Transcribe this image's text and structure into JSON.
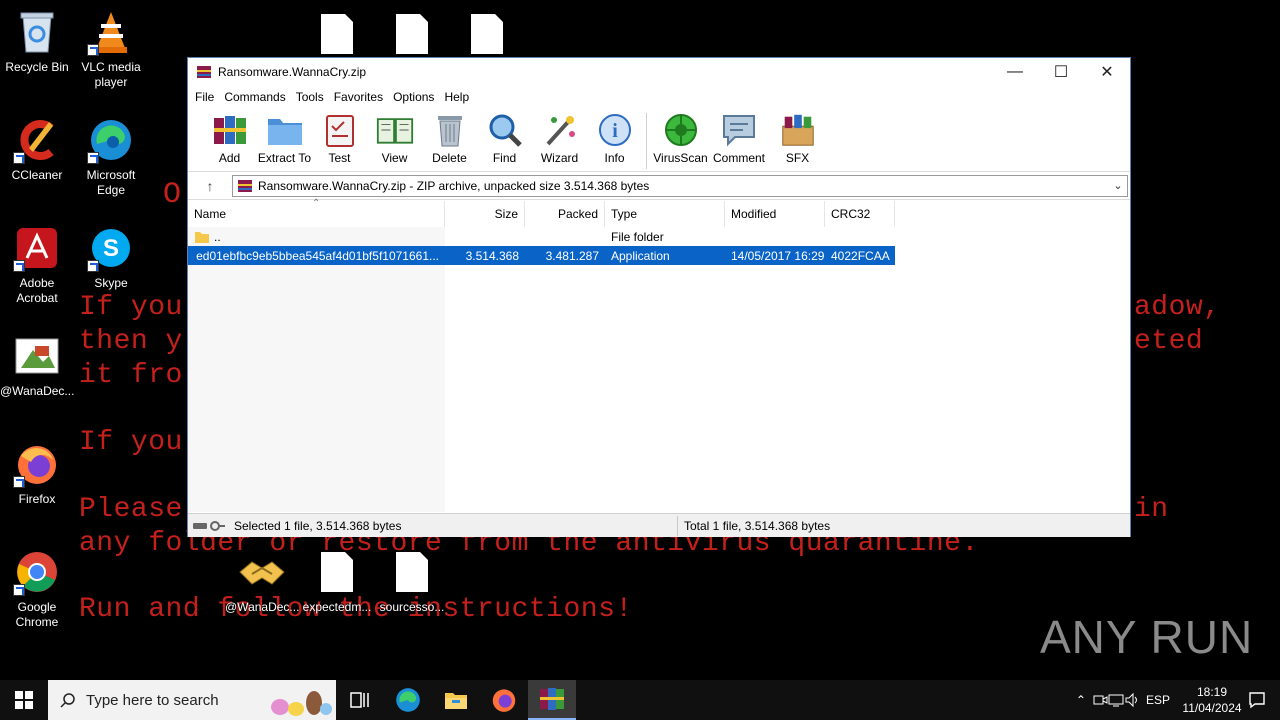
{
  "wallpaper": {
    "big_letter": "O",
    "lines": [
      "If you",
      "then y",
      "it fro",
      "If you",
      "Please",
      "any folder or restore from the antivirus quarantine.",
      "Run and follow the instructions!"
    ],
    "right_fragments": [
      "adow,",
      "eted",
      "in"
    ]
  },
  "desktop": {
    "icons_left": [
      {
        "label": "Recycle Bin",
        "icon": "recycle-bin-icon"
      },
      {
        "label": "VLC media player",
        "icon": "vlc-icon"
      },
      {
        "label": "CCleaner",
        "icon": "ccleaner-icon"
      },
      {
        "label": "Microsoft Edge",
        "icon": "edge-icon"
      },
      {
        "label": "Adobe Acrobat",
        "icon": "acrobat-icon"
      },
      {
        "label": "Skype",
        "icon": "skype-icon"
      },
      {
        "label": "@WanaDec...",
        "icon": "wanadecryptor-image-icon"
      },
      {
        "label": "Firefox",
        "icon": "firefox-icon"
      },
      {
        "label": "Google Chrome",
        "icon": "chrome-icon"
      }
    ],
    "icons_bottom": [
      {
        "label": "@WanaDec...",
        "icon": "handshake-icon"
      },
      {
        "label": "expectedm...",
        "icon": "file-icon"
      },
      {
        "label": "sourcesso...",
        "icon": "file-icon"
      }
    ]
  },
  "window": {
    "title": "Ransomware.WannaCry.zip",
    "menu": [
      "File",
      "Commands",
      "Tools",
      "Favorites",
      "Options",
      "Help"
    ],
    "toolbar": [
      {
        "label": "Add",
        "icon": "add-archive-icon"
      },
      {
        "label": "Extract To",
        "icon": "extract-folder-icon"
      },
      {
        "label": "Test",
        "icon": "test-clipboard-icon"
      },
      {
        "label": "View",
        "icon": "view-book-icon"
      },
      {
        "label": "Delete",
        "icon": "trash-icon"
      },
      {
        "label": "Find",
        "icon": "magnifier-icon"
      },
      {
        "label": "Wizard",
        "icon": "magic-wand-icon"
      },
      {
        "label": "Info",
        "icon": "info-icon"
      },
      {
        "label": "VirusScan",
        "icon": "virus-scan-icon"
      },
      {
        "label": "Comment",
        "icon": "comment-icon"
      },
      {
        "label": "SFX",
        "icon": "sfx-box-icon"
      }
    ],
    "address": "Ransomware.WannaCry.zip - ZIP archive, unpacked size 3.514.368 bytes",
    "columns": [
      "Name",
      "Size",
      "Packed",
      "Type",
      "Modified",
      "CRC32"
    ],
    "rows": [
      {
        "name": "..",
        "size": "",
        "packed": "",
        "type": "File folder",
        "modified": "",
        "crc": ""
      },
      {
        "name": "ed01ebfbc9eb5bbea545af4d01bf5f1071661...",
        "size": "3.514.368",
        "packed": "3.481.287",
        "type": "Application",
        "modified": "14/05/2017 16:29",
        "crc": "4022FCAA"
      }
    ],
    "status_left": "Selected 1 file, 3.514.368 bytes",
    "status_right": "Total 1 file, 3.514.368 bytes"
  },
  "taskbar": {
    "search_placeholder": "Type here to search",
    "language": "ESP",
    "time": "18:19",
    "date": "11/04/2024"
  },
  "watermark": "ANY RUN"
}
